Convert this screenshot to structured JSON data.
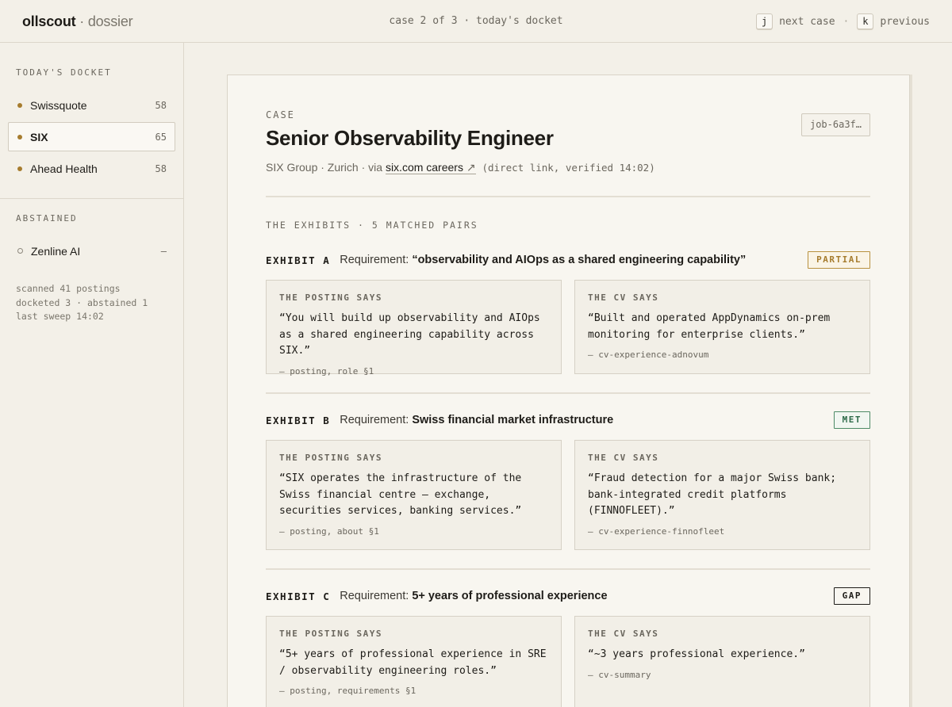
{
  "app": {
    "brand_primary": "ollscout",
    "brand_secondary": "· dossier",
    "position": "case 2 of 3 · today's docket",
    "next_key": "j",
    "next_label": "next case",
    "separator": "·",
    "prev_key": "k",
    "prev_label": "previous"
  },
  "sidebar": {
    "docket_heading": "TODAY'S DOCKET",
    "docket": [
      {
        "name": "Swissquote",
        "score": "58"
      },
      {
        "name": "SIX",
        "score": "65",
        "active": true
      },
      {
        "name": "Ahead Health",
        "score": "58"
      }
    ],
    "abstained_heading": "ABSTAINED",
    "abstained": [
      {
        "name": "Zenline AI",
        "score": "—"
      }
    ],
    "stats": [
      "scanned 41 postings",
      "docketed 3 · abstained 1",
      "last sweep 14:02"
    ]
  },
  "case": {
    "label": "CASE",
    "job_id": "job-6a3f…",
    "title": "Senior Observability Engineer",
    "company": "SIX Group · Zurich · via",
    "source_link": "six.com careers",
    "link_arrow": "↗",
    "source_note": "(direct link, verified 14:02)",
    "exhibits_heading": "THE EXHIBITS · 5 MATCHED PAIRS",
    "req_prefix": "Requirement:",
    "posting_label": "THE POSTING SAYS",
    "cv_label": "THE CV SAYS",
    "exhibits": [
      {
        "label": "EXHIBIT A",
        "requirement": "“observability and AIOps as a shared engineering capability”",
        "status": "PARTIAL",
        "posting_quote": "“You will build up observability and AIOps as a shared engineering capability across SIX.”",
        "posting_src": "— posting, role §1",
        "cv_quote": "“Built and operated AppDynamics on-prem monitoring for enterprise clients.”",
        "cv_src": "— cv-experience-adnovum"
      },
      {
        "label": "EXHIBIT B",
        "requirement": "Swiss financial market infrastructure",
        "status": "MET",
        "posting_quote": "“SIX operates the infrastructure of the Swiss financial centre — exchange, securities services, banking services.”",
        "posting_src": "— posting, about §1",
        "cv_quote": "“Fraud detection for a major Swiss bank; bank-integrated credit platforms (FINNOFLEET).”",
        "cv_src": "— cv-experience-finnofleet"
      },
      {
        "label": "EXHIBIT C",
        "requirement": "5+ years of professional experience",
        "status": "GAP",
        "posting_quote": "“5+ years of professional experience in SRE / observability engineering roles.”",
        "posting_src": "— posting, requirements §1",
        "cv_quote": "“~3 years professional experience.”",
        "cv_src": "— cv-summary"
      }
    ]
  },
  "colors": {
    "background": "#f3f0e8",
    "accent_gold": "#a67c2e",
    "met_green": "#2f6b4a",
    "text": "#1e1c18"
  }
}
